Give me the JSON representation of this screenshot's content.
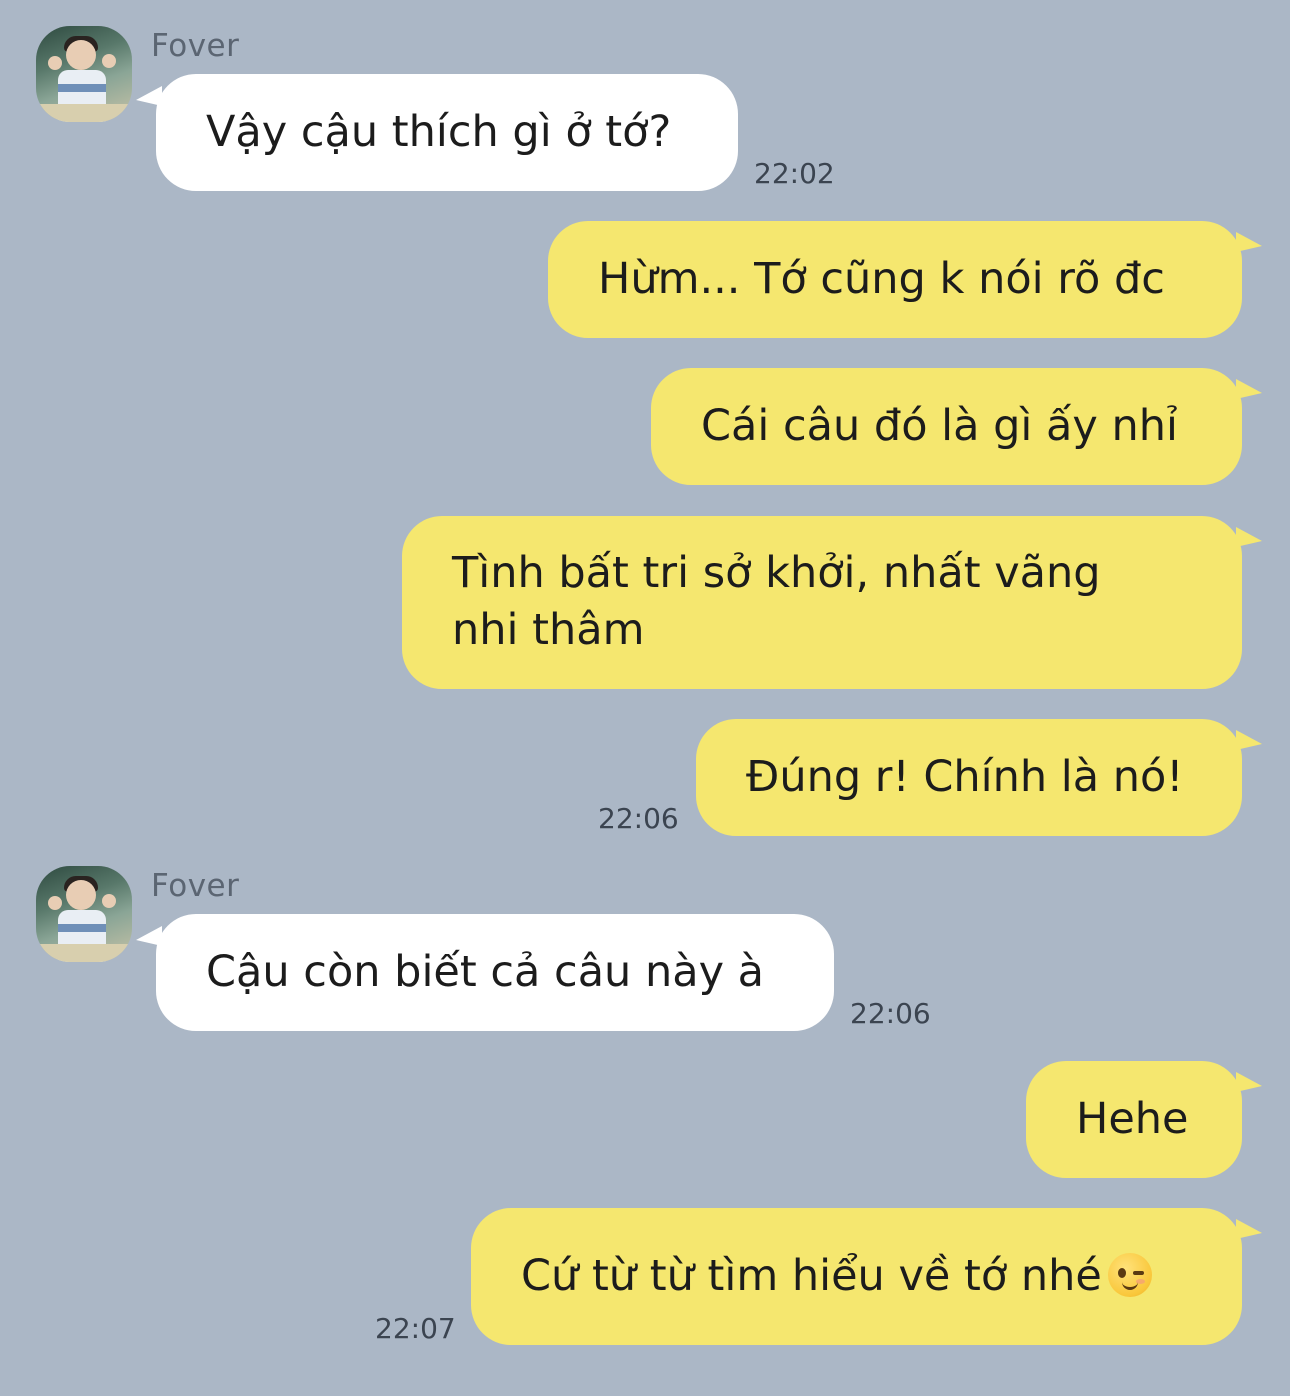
{
  "chat": {
    "messages": [
      {
        "sender": "Fover",
        "direction": "incoming",
        "text": "Vậy cậu thích gì ở tớ?",
        "time": "22:02"
      },
      {
        "direction": "outgoing",
        "text": "Hừm... Tớ cũng k nói rõ đc"
      },
      {
        "direction": "outgoing",
        "text": "Cái câu đó là gì ấy nhỉ"
      },
      {
        "direction": "outgoing",
        "text_line1": "Tình bất tri sở khởi, nhất vãng",
        "text_line2": "nhi thâm"
      },
      {
        "direction": "outgoing",
        "text": "Đúng r! Chính là nó!",
        "time": "22:06"
      },
      {
        "sender": "Fover",
        "direction": "incoming",
        "text": "Cậu còn biết cả câu này à",
        "time": "22:06"
      },
      {
        "direction": "outgoing",
        "text": "Hehe"
      },
      {
        "direction": "outgoing",
        "text": "Cứ từ từ tìm hiểu về tớ nhé",
        "emoji": "winking-face-icon",
        "time": "22:07"
      }
    ]
  },
  "colors": {
    "background": "#abb7c6",
    "incoming_bubble": "#ffffff",
    "outgoing_bubble": "#f5e76f",
    "timestamp": "#3b4450",
    "sender_name": "#5b6572"
  }
}
